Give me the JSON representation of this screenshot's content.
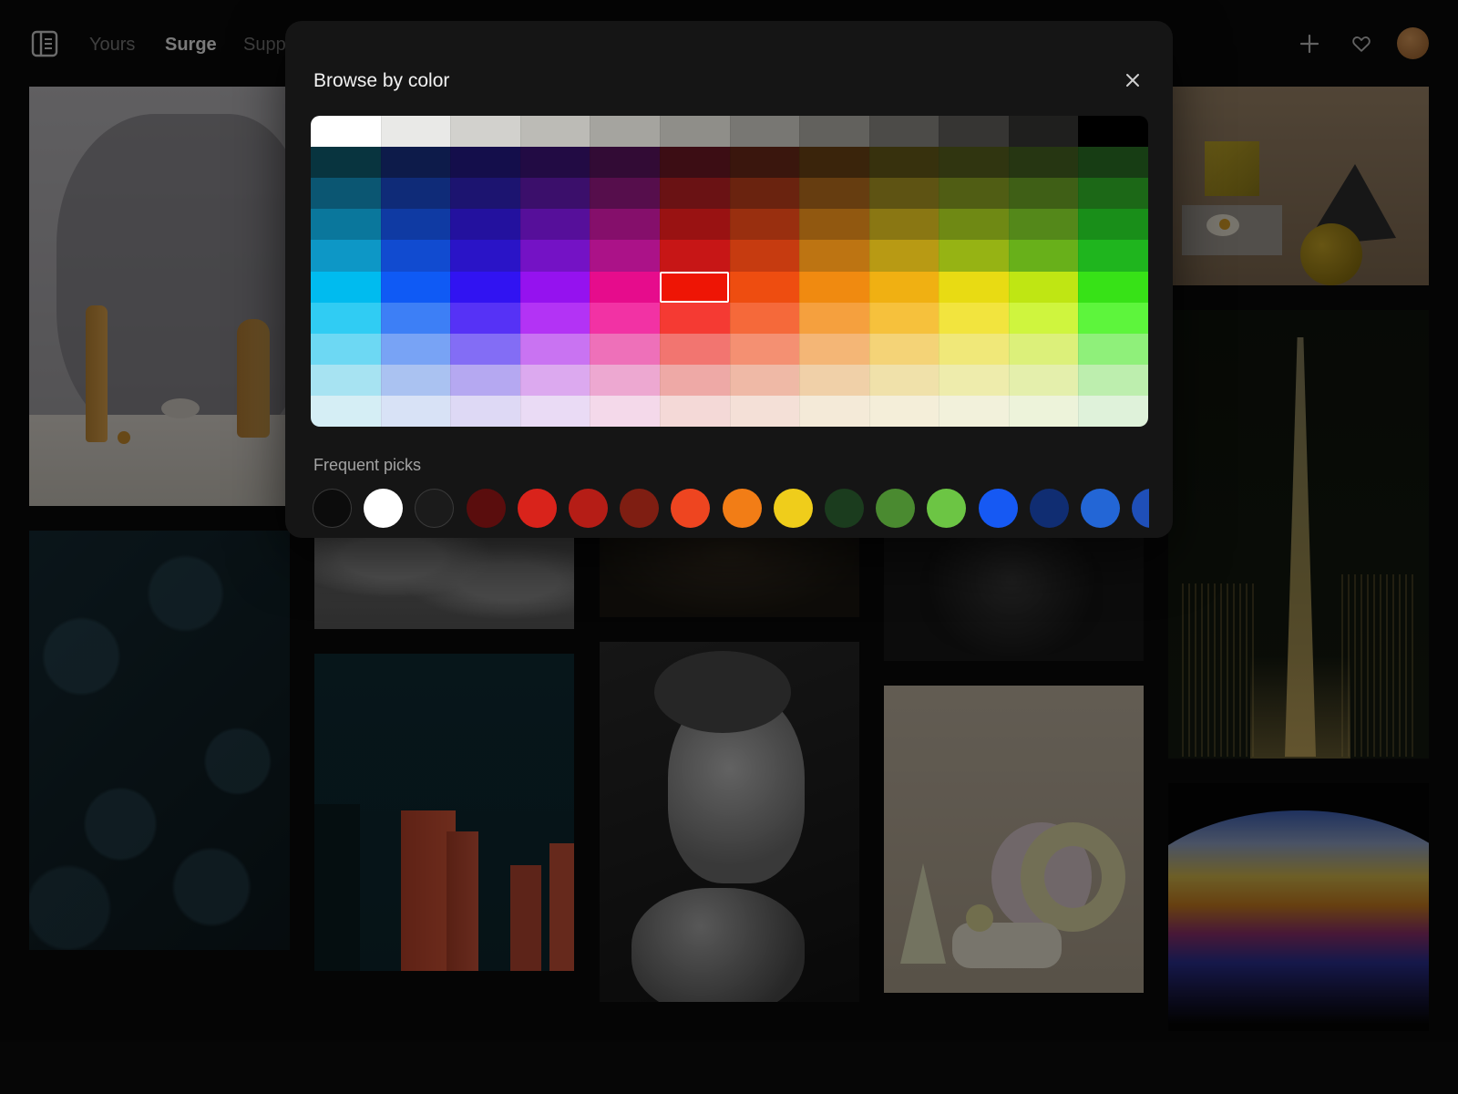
{
  "nav": {
    "tabs": [
      {
        "label": "Yours",
        "active": false
      },
      {
        "label": "Surge",
        "active": true
      },
      {
        "label": "Supp",
        "active": false
      }
    ]
  },
  "header_actions": {
    "add_icon": "plus-icon",
    "favorites_icon": "heart-icon",
    "avatar_color": "#c3803f"
  },
  "gallery": {
    "photos": [
      "vases-still-life",
      "dark-leaf-texture",
      "sand-dunes-bw",
      "red-buildings-night",
      "dark-sparkle",
      "woman-portrait-bw",
      "arms-bw",
      "pastel-shapes",
      "yellow-cube-still-life",
      "tower-night-lights",
      "rainbow-bubble"
    ]
  },
  "modal": {
    "title": "Browse by color",
    "close_icon": "close-icon",
    "palette": {
      "columns": 12,
      "rows": [
        [
          "#ffffff",
          "#e9e9e7",
          "#d2d1cd",
          "#bcbbb6",
          "#a5a49f",
          "#8f8e89",
          "#787773",
          "#62615d",
          "#4c4b48",
          "#363533",
          "#1f1f1e",
          "#000000"
        ],
        [
          "#08343f",
          "#0d1b4a",
          "#140e4b",
          "#220b44",
          "#320b35",
          "#3c0d14",
          "#3a160d",
          "#3a240b",
          "#37310d",
          "#303510",
          "#263612",
          "#173d14"
        ],
        [
          "#0b5672",
          "#0f2b78",
          "#1c1470",
          "#3b0f6b",
          "#560e4c",
          "#6a1214",
          "#6a230f",
          "#663d10",
          "#5e5313",
          "#505d14",
          "#3f5f16",
          "#1c6817"
        ],
        [
          "#0a779c",
          "#0f3aa3",
          "#23119e",
          "#560f9a",
          "#850f6b",
          "#991212",
          "#992f0f",
          "#915810",
          "#8a7713",
          "#6f8914",
          "#54881a",
          "#198e19"
        ],
        [
          "#0d97c6",
          "#114bd0",
          "#2a14c7",
          "#7412c5",
          "#ab1288",
          "#c71616",
          "#c63b10",
          "#bd7412",
          "#b89a14",
          "#96b314",
          "#68b01a",
          "#1fb51e"
        ],
        [
          "#00bbef",
          "#0f5af5",
          "#3113f2",
          "#9512ef",
          "#e60c8c",
          "#ee1505",
          "#ee4d10",
          "#f08a10",
          "#f0b012",
          "#e8db13",
          "#bfe613",
          "#37e217"
        ],
        [
          "#30ccf3",
          "#3d7ff6",
          "#5632f6",
          "#b333f5",
          "#f232a4",
          "#f53a33",
          "#f5693a",
          "#f5a03e",
          "#f6c13c",
          "#f2e43e",
          "#cff53e",
          "#5df53c"
        ],
        [
          "#6dd8f3",
          "#78a3f5",
          "#836df5",
          "#c973f2",
          "#ee70b9",
          "#f27570",
          "#f49072",
          "#f4b676",
          "#f4d377",
          "#f0e879",
          "#dcf07a",
          "#8ff07a"
        ],
        [
          "#a7e3f2",
          "#aac2f1",
          "#b5a8f1",
          "#dca9ef",
          "#eda8d1",
          "#eea9a6",
          "#efb9a6",
          "#f0d0a8",
          "#f0e1aa",
          "#eeecac",
          "#e4efac",
          "#bdeeae"
        ],
        [
          "#d5eef5",
          "#d8e2f6",
          "#ded9f5",
          "#eadbf5",
          "#f4d9ea",
          "#f4d9d7",
          "#f4e0d7",
          "#f4ead8",
          "#f4eed9",
          "#f2f1db",
          "#edf3da",
          "#dff2da"
        ]
      ],
      "selected": {
        "row": 5,
        "col": 5
      }
    },
    "frequent_label": "Frequent picks",
    "frequent": [
      "#0c0c0c",
      "#ffffff",
      "#1b1b1b",
      "#5a0d0d",
      "#d9231b",
      "#b51d16",
      "#7f1e12",
      "#ee4520",
      "#f27d16",
      "#efcd1b",
      "#1b3c1e",
      "#4a8a30",
      "#6cc544",
      "#1659f3",
      "#102d72",
      "#2366d6",
      "#1f4fb8"
    ]
  }
}
